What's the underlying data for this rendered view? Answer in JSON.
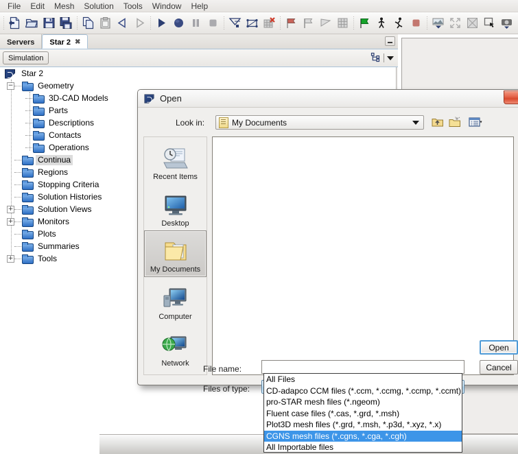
{
  "menubar": {
    "items": [
      {
        "label": "File"
      },
      {
        "label": "Edit"
      },
      {
        "label": "Mesh"
      },
      {
        "label": "Solution"
      },
      {
        "label": "Tools"
      },
      {
        "label": "Window"
      },
      {
        "label": "Help"
      }
    ]
  },
  "toolbar": {
    "groups": [
      [
        "new-document-icon",
        "open-folder-icon",
        "save-icon",
        "save-all-icon"
      ],
      [
        "copy-icon",
        "paste-icon",
        "step-back-icon",
        "step-forward-icon"
      ],
      [
        "play-icon",
        "sphere-icon",
        "pause-icon",
        "stop-icon"
      ],
      [
        "mesh-generate-icon",
        "surface-remesher-icon",
        "clear-mesh-icon"
      ],
      [
        "flag-red-icon",
        "flag-grey-icon",
        "flag-fold-icon",
        "grid-icon"
      ],
      [
        "flag-green-icon",
        "walk-icon",
        "run-icon",
        "stop-red-icon"
      ],
      [
        "scene-image-icon",
        "fit-view-icon",
        "reset-view-icon",
        "select-region-icon",
        "camera-icon",
        "back-arrow-icon",
        "forward-arrow-icon",
        "sphere-grey-icon"
      ]
    ]
  },
  "explorer": {
    "tabs": [
      {
        "label": "Servers",
        "active": false,
        "closeable": false
      },
      {
        "label": "Star 2",
        "active": true,
        "closeable": true
      }
    ],
    "tab_close_glyph": "✖",
    "minimize_label": "Minimize",
    "subtoolbar": {
      "simulation_button": "Simulation",
      "tree_icon": "tree-structure-icon",
      "dropdown_icon": "chevron-down-icon"
    },
    "tree": {
      "root": {
        "label": "Star 2",
        "icon": "star-ccm-icon"
      },
      "nodes": [
        {
          "label": "Geometry",
          "depth": 1,
          "expander": "-",
          "selected": false
        },
        {
          "label": "3D-CAD Models",
          "depth": 2,
          "expander": "",
          "selected": false
        },
        {
          "label": "Parts",
          "depth": 2,
          "expander": "",
          "selected": false
        },
        {
          "label": "Descriptions",
          "depth": 2,
          "expander": "",
          "selected": false
        },
        {
          "label": "Contacts",
          "depth": 2,
          "expander": "",
          "selected": false
        },
        {
          "label": "Operations",
          "depth": 2,
          "expander": "",
          "selected": false
        },
        {
          "label": "Continua",
          "depth": 1,
          "expander": "",
          "selected": true
        },
        {
          "label": "Regions",
          "depth": 1,
          "expander": "",
          "selected": false
        },
        {
          "label": "Stopping Criteria",
          "depth": 1,
          "expander": "",
          "selected": false
        },
        {
          "label": "Solution Histories",
          "depth": 1,
          "expander": "",
          "selected": false
        },
        {
          "label": "Solution Views",
          "depth": 1,
          "expander": "+",
          "selected": false
        },
        {
          "label": "Monitors",
          "depth": 1,
          "expander": "+",
          "selected": false
        },
        {
          "label": "Plots",
          "depth": 1,
          "expander": "",
          "selected": false
        },
        {
          "label": "Summaries",
          "depth": 1,
          "expander": "",
          "selected": false
        },
        {
          "label": "Tools",
          "depth": 1,
          "expander": "+",
          "selected": false
        }
      ]
    }
  },
  "dialog": {
    "title": "Open",
    "title_icon": "star-ccm-icon",
    "close_button": "close-icon",
    "lookin": {
      "label": "Look in:",
      "value": "My Documents",
      "icon": "my-documents-icon",
      "dropdown_icon": "chevron-down-icon"
    },
    "toolbar_buttons": [
      {
        "name": "up-one-level-icon"
      },
      {
        "name": "new-folder-icon"
      },
      {
        "name": "view-menu-icon"
      }
    ],
    "places": [
      {
        "label": "Recent Items",
        "icon": "recent-items-icon",
        "selected": false
      },
      {
        "label": "Desktop",
        "icon": "desktop-icon",
        "selected": false
      },
      {
        "label": "My Documents",
        "icon": "my-documents-icon",
        "selected": true
      },
      {
        "label": "Computer",
        "icon": "computer-icon",
        "selected": false
      },
      {
        "label": "Network",
        "icon": "network-icon",
        "selected": false
      }
    ],
    "file_list": {
      "items": []
    },
    "file_name": {
      "label": "File name:",
      "value": "",
      "placeholder": ""
    },
    "files_of_type": {
      "label": "Files of type:",
      "value": "All Importable files",
      "dropdown_icon": "chevron-down-icon",
      "options": [
        {
          "label": "All Files",
          "highlighted": false
        },
        {
          "label": "CD-adapco CCM files (*.ccm, *.ccmg, *.ccmp, *.ccmt)",
          "highlighted": false
        },
        {
          "label": "pro-STAR mesh files (*.ngeom)",
          "highlighted": false
        },
        {
          "label": "Fluent case files (*.cas, *.grd, *.msh)",
          "highlighted": false
        },
        {
          "label": "Plot3D mesh files (*.grd, *.msh, *.p3d, *.xyz, *.x)",
          "highlighted": false
        },
        {
          "label": "CGNS mesh files (*.cgns, *.cga, *.cgh)",
          "highlighted": true
        },
        {
          "label": "All Importable files",
          "highlighted": false
        }
      ]
    },
    "buttons": {
      "open": "Open",
      "cancel": "Cancel"
    }
  },
  "colors": {
    "accent_blue": "#3d95e8",
    "folder_blue": "#2e6fc4",
    "close_red": "#d94a2e",
    "selection_grey": "#dcdcdc",
    "window_bg": "#f0efed"
  }
}
